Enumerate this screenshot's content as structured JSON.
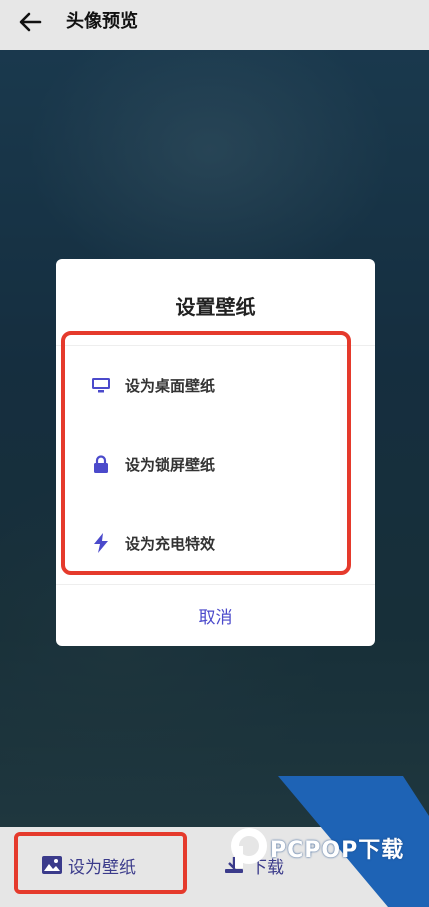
{
  "header": {
    "title": "头像预览"
  },
  "dialog": {
    "title": "设置壁纸",
    "options": [
      {
        "label": "设为桌面壁纸",
        "icon": "monitor-icon"
      },
      {
        "label": "设为锁屏壁纸",
        "icon": "lock-icon"
      },
      {
        "label": "设为充电特效",
        "icon": "lightning-icon"
      }
    ],
    "cancel_label": "取消"
  },
  "bottom_bar": {
    "set_wallpaper_label": "设为壁纸",
    "download_label": "下载"
  },
  "watermark": {
    "text": "PCPOP下载"
  },
  "colors": {
    "accent": "#4b4acb",
    "highlight_red": "#e53a2c",
    "watermark_blue": "#1e63b5"
  }
}
